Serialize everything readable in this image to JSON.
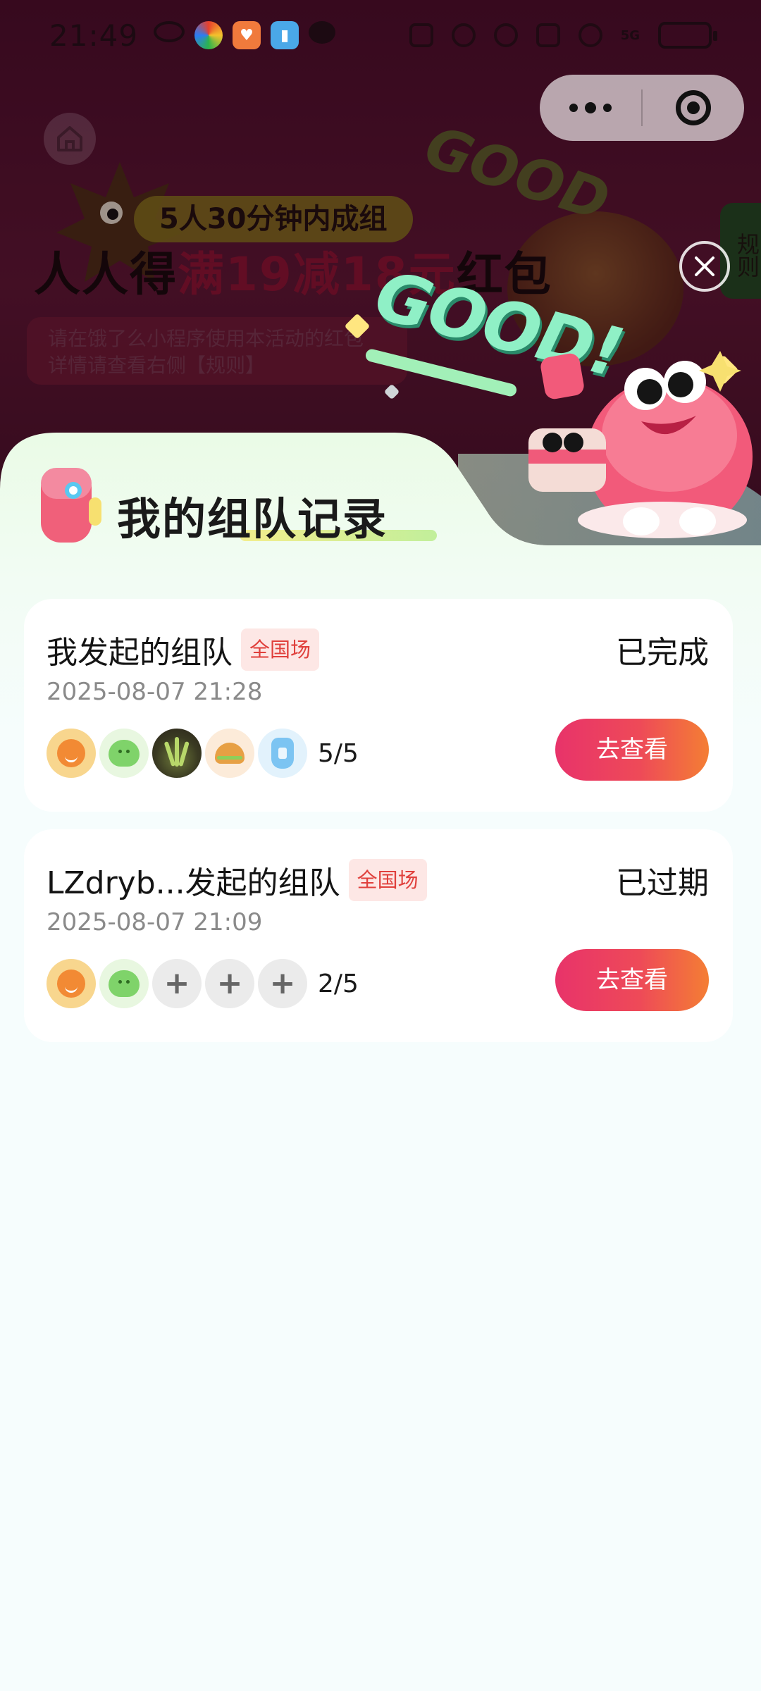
{
  "status_bar": {
    "time": "21:49",
    "signal_label": "5G"
  },
  "background_page": {
    "subtitle": "5人30分钟内成组",
    "title_prefix": "人人得",
    "title_highlight": "满19减18元",
    "title_suffix": "红包",
    "note": "请在饿了么小程序使用本活动的红包\n详情请查看右侧【规则】",
    "rule_tab": "规则",
    "good_text": "GOOD"
  },
  "header": {
    "good_text": "GOOD!",
    "title": "我的组队记录"
  },
  "records": [
    {
      "name": "我发起的组队",
      "tag": "全国场",
      "status": "已完成",
      "time": "2025-08-07 21:28",
      "count": "5/5",
      "button_label": "去查看",
      "avatars": [
        "orange-face-avatar",
        "green-blob-avatar",
        "plant-photo-avatar",
        "burger-avatar",
        "blue-cup-avatar"
      ]
    },
    {
      "name": "LZdryb...发起的组队",
      "tag": "全国场",
      "status": "已过期",
      "time": "2025-08-07 21:09",
      "count": "2/5",
      "button_label": "去查看",
      "avatars": [
        "orange-face-avatar",
        "green-blob-avatar",
        "empty-slot",
        "empty-slot",
        "empty-slot"
      ]
    }
  ],
  "colors": {
    "button_gradient_start": "#e8336a",
    "button_gradient_end": "#f47e34",
    "tag_background": "#fde7e5",
    "tag_text": "#e0403c",
    "sheet_background": "#f6fdfd"
  }
}
